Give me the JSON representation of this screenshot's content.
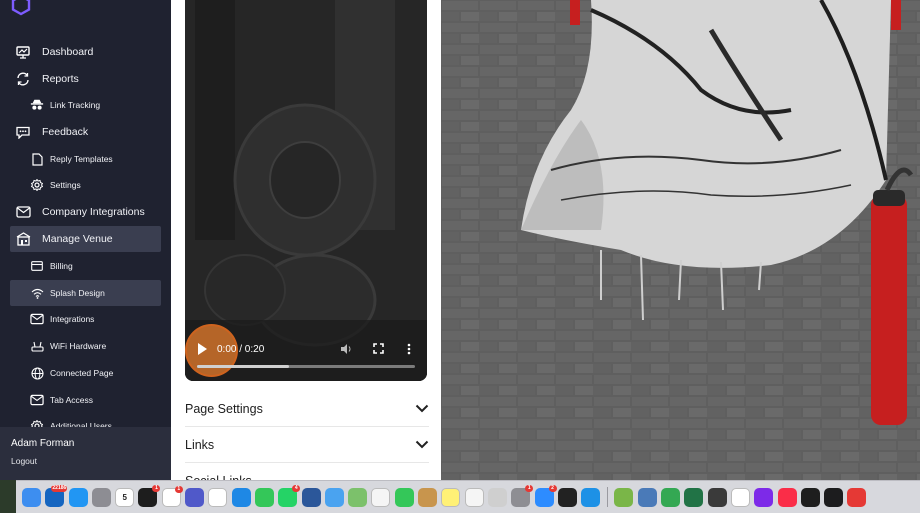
{
  "sidebar": {
    "nav": [
      {
        "label": "Dashboard",
        "icon": "dashboard-icon",
        "level": "top"
      },
      {
        "label": "Reports",
        "icon": "refresh-icon",
        "level": "top"
      },
      {
        "label": "Link Tracking",
        "icon": "spy-icon",
        "level": "sub"
      },
      {
        "label": "Feedback",
        "icon": "chat-icon",
        "level": "top"
      },
      {
        "label": "Reply Templates",
        "icon": "document-icon",
        "level": "sub"
      },
      {
        "label": "Settings",
        "icon": "gear-icon",
        "level": "sub"
      },
      {
        "label": "Company Integrations",
        "icon": "mail-icon",
        "level": "top"
      },
      {
        "label": "Manage Venue",
        "icon": "venue-icon",
        "level": "top",
        "active": true
      },
      {
        "label": "Billing",
        "icon": "card-icon",
        "level": "sub"
      },
      {
        "label": "Splash Design",
        "icon": "wifi-icon",
        "level": "sub",
        "active": true
      },
      {
        "label": "Integrations",
        "icon": "mail-icon",
        "level": "sub"
      },
      {
        "label": "WiFi Hardware",
        "icon": "router-icon",
        "level": "sub"
      },
      {
        "label": "Connected Page",
        "icon": "globe-icon",
        "level": "sub"
      },
      {
        "label": "Tab Access",
        "icon": "mail-icon",
        "level": "sub"
      },
      {
        "label": "Additional Users",
        "icon": "gear-icon",
        "level": "sub"
      }
    ],
    "user": {
      "name": "Adam Forman",
      "logout": "Logout"
    }
  },
  "video": {
    "time": "0:00 / 0:20",
    "progress": 0.42
  },
  "sections": [
    {
      "title": "Page Settings"
    },
    {
      "title": "Links"
    },
    {
      "title": "Social Links"
    }
  ],
  "dock": {
    "apps": [
      {
        "name": "finder",
        "color": "#3d8ef0"
      },
      {
        "name": "outlook",
        "color": "#1565c0",
        "badge": "22186"
      },
      {
        "name": "app-store",
        "color": "#2196f3"
      },
      {
        "name": "launchpad",
        "color": "#8d8d93"
      },
      {
        "name": "calendar",
        "color": "#ffffff",
        "text": "5"
      },
      {
        "name": "jira",
        "color": "#1d1d1d",
        "badge": "1"
      },
      {
        "name": "slack",
        "color": "#ffffff",
        "badge": "1"
      },
      {
        "name": "teams",
        "color": "#5059c9"
      },
      {
        "name": "chrome",
        "color": "#ffffff"
      },
      {
        "name": "safari",
        "color": "#1e88e5"
      },
      {
        "name": "messages",
        "color": "#34c759"
      },
      {
        "name": "whatsapp",
        "color": "#25d366",
        "badge": "4"
      },
      {
        "name": "word",
        "color": "#2b579a"
      },
      {
        "name": "mail",
        "color": "#4aa3f0"
      },
      {
        "name": "maps",
        "color": "#7cc16b"
      },
      {
        "name": "photos",
        "color": "#f5f5f5"
      },
      {
        "name": "facetime",
        "color": "#34c759"
      },
      {
        "name": "notes-brown",
        "color": "#c8954d"
      },
      {
        "name": "notes",
        "color": "#fff176"
      },
      {
        "name": "reminders",
        "color": "#f5f5f5"
      },
      {
        "name": "screenshot",
        "color": "#cfcfcf"
      },
      {
        "name": "system-settings",
        "color": "#8e8e93",
        "badge": "1"
      },
      {
        "name": "zoom",
        "color": "#2d8cff",
        "badge": "2"
      },
      {
        "name": "spark",
        "color": "#222222"
      },
      {
        "name": "docker",
        "color": "#1d91e6"
      },
      {
        "name": "webex",
        "color": "#7ab648"
      },
      {
        "name": "preview",
        "color": "#4a7ab8"
      },
      {
        "name": "numbers",
        "color": "#34a853"
      },
      {
        "name": "excel",
        "color": "#217346"
      },
      {
        "name": "calculator",
        "color": "#3a3a3a"
      },
      {
        "name": "vectornator",
        "color": "#ffffff"
      },
      {
        "name": "canva",
        "color": "#7d2ae8"
      },
      {
        "name": "music",
        "color": "#fa2d48"
      },
      {
        "name": "terminal",
        "color": "#1e1e1e"
      },
      {
        "name": "quicktime",
        "color": "#1c1c1e"
      },
      {
        "name": "todo",
        "color": "#e53935"
      }
    ]
  }
}
